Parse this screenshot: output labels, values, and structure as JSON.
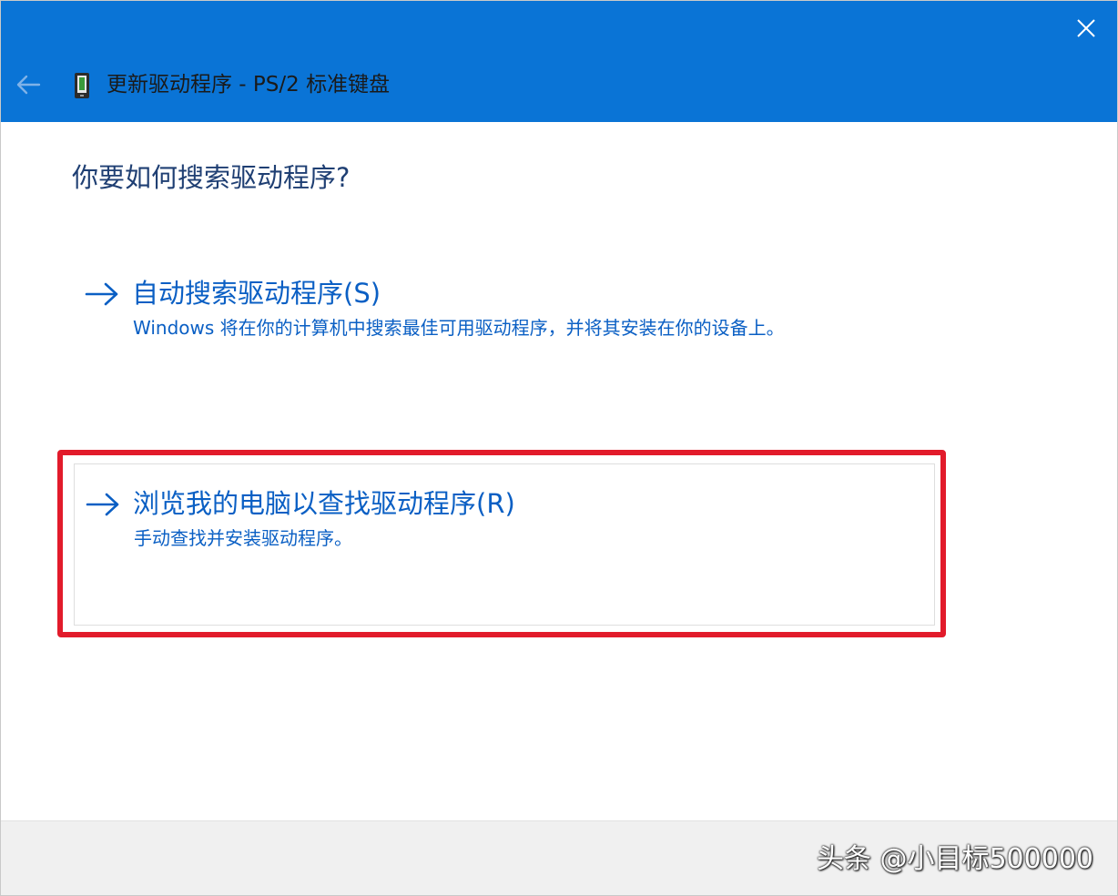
{
  "window": {
    "title": "更新驱动程序 - PS/2 标准键盘",
    "icons": {
      "back": "back-arrow-icon",
      "device": "keyboard-device-icon",
      "close": "close-icon"
    }
  },
  "main": {
    "question": "你要如何搜索驱动程序?",
    "options": [
      {
        "title": "自动搜索驱动程序(S)",
        "description": "Windows 将在你的计算机中搜索最佳可用驱动程序，并将其安装在你的设备上。"
      },
      {
        "title": "浏览我的电脑以查找驱动程序(R)",
        "description": "手动查找并安装驱动程序。"
      }
    ]
  },
  "watermark": {
    "text": "头条 @小目标500000"
  },
  "colors": {
    "titlebar": "#0a74d6",
    "link": "#0a5fc4",
    "highlight": "#e21b2b"
  }
}
